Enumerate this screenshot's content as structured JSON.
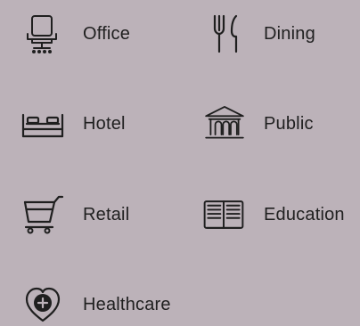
{
  "theme": {
    "background": "#bcb2b9",
    "text": "#202020",
    "icon": "#1f1f1f"
  },
  "categories": [
    {
      "key": "office",
      "label": "Office",
      "icon": "office-chair-icon"
    },
    {
      "key": "dining",
      "label": "Dining",
      "icon": "fork-knife-icon"
    },
    {
      "key": "hotel",
      "label": "Hotel",
      "icon": "bed-icon"
    },
    {
      "key": "public",
      "label": "Public",
      "icon": "public-building-icon"
    },
    {
      "key": "retail",
      "label": "Retail",
      "icon": "shopping-cart-icon"
    },
    {
      "key": "education",
      "label": "Education",
      "icon": "open-book-icon"
    },
    {
      "key": "healthcare",
      "label": "Healthcare",
      "icon": "heart-cross-icon"
    }
  ]
}
